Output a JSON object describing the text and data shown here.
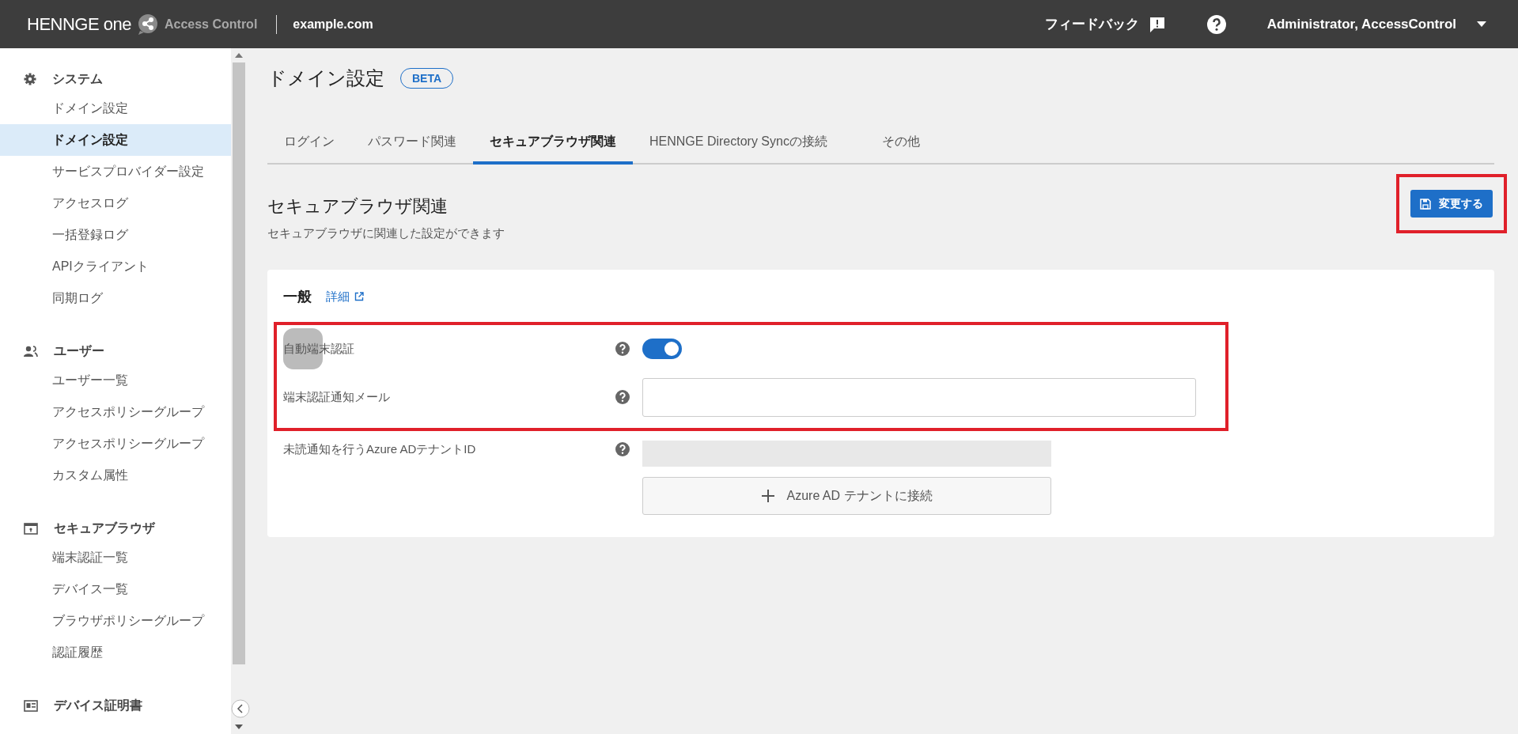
{
  "header": {
    "brand": "HENNGE one",
    "product": "Access Control",
    "domain": "example.com",
    "feedback": "フィードバック",
    "user": "Administrator, AccessControl"
  },
  "sidebar": {
    "sections": [
      {
        "kind": "gear",
        "title": "システム",
        "items": [
          {
            "label": "ドメイン設定",
            "selected": false
          },
          {
            "label": "ドメイン設定",
            "selected": true
          },
          {
            "label": "サービスプロバイダー設定",
            "selected": false
          },
          {
            "label": "アクセスログ",
            "selected": false
          },
          {
            "label": "一括登録ログ",
            "selected": false
          },
          {
            "label": "APIクライアント",
            "selected": false
          },
          {
            "label": "同期ログ",
            "selected": false
          }
        ]
      },
      {
        "kind": "people",
        "title": "ユーザー",
        "items": [
          {
            "label": "ユーザー一覧",
            "selected": false
          },
          {
            "label": "アクセスポリシーグループ",
            "selected": false
          },
          {
            "label": "アクセスポリシーグループ",
            "selected": false
          },
          {
            "label": "カスタム属性",
            "selected": false
          }
        ]
      },
      {
        "kind": "browser",
        "title": "セキュアブラウザ",
        "items": [
          {
            "label": "端末認証一覧",
            "selected": false
          },
          {
            "label": "デバイス一覧",
            "selected": false
          },
          {
            "label": "ブラウザポリシーグループ",
            "selected": false
          },
          {
            "label": "認証履歴",
            "selected": false
          }
        ]
      },
      {
        "kind": "card",
        "title": "デバイス証明書"
      }
    ]
  },
  "page": {
    "title": "ドメイン設定",
    "badge": "BETA"
  },
  "tabs": [
    {
      "label": "ログイン",
      "selected": false
    },
    {
      "label": "パスワード関連",
      "selected": false
    },
    {
      "label": "セキュアブラウザ関連",
      "selected": true
    },
    {
      "label": "HENNGE Directory Syncの接続",
      "selected": false
    },
    {
      "label": "その他",
      "selected": false
    }
  ],
  "section": {
    "title": "セキュアブラウザ関連",
    "subtitle": "セキュアブラウザに関連した設定ができます",
    "save_button": {
      "label": "変更する",
      "highlighted": true
    }
  },
  "card": {
    "title": "一般",
    "link": "詳細",
    "rows": [
      {
        "kind": "toggle",
        "label": "自動端末認証",
        "on": true,
        "highlighted": true
      },
      {
        "kind": "text",
        "label": "端末認証通知メール",
        "highlighted": true
      },
      {
        "kind": "azure",
        "label": "未読通知を行うAzure ADテナントID",
        "button": "Azure AD テナントに接続",
        "highlighted": false
      }
    ]
  }
}
